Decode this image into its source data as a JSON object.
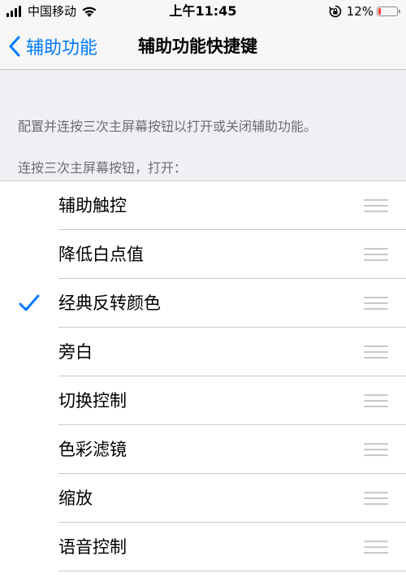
{
  "status_bar": {
    "carrier": "中国移动",
    "time": "上午11:45",
    "battery_text": "12%",
    "battery_level": 0.12,
    "battery_color": "#ff3b30"
  },
  "nav": {
    "back_label": "辅助功能",
    "title": "辅助功能快捷键",
    "back_icon": "chevron-left-icon"
  },
  "description": "配置并连按三次主屏幕按钮以打开或关闭辅助功能。",
  "section_header": "连按三次主屏幕按钮，打开：",
  "items": [
    {
      "label": "辅助触控",
      "checked": false
    },
    {
      "label": "降低白点值",
      "checked": false
    },
    {
      "label": "经典反转颜色",
      "checked": true
    },
    {
      "label": "旁白",
      "checked": false
    },
    {
      "label": "切换控制",
      "checked": false
    },
    {
      "label": "色彩滤镜",
      "checked": false
    },
    {
      "label": "缩放",
      "checked": false
    },
    {
      "label": "语音控制",
      "checked": false
    }
  ],
  "colors": {
    "accent": "#007aff",
    "background": "#efeff4",
    "separator": "#c8c7cc"
  }
}
